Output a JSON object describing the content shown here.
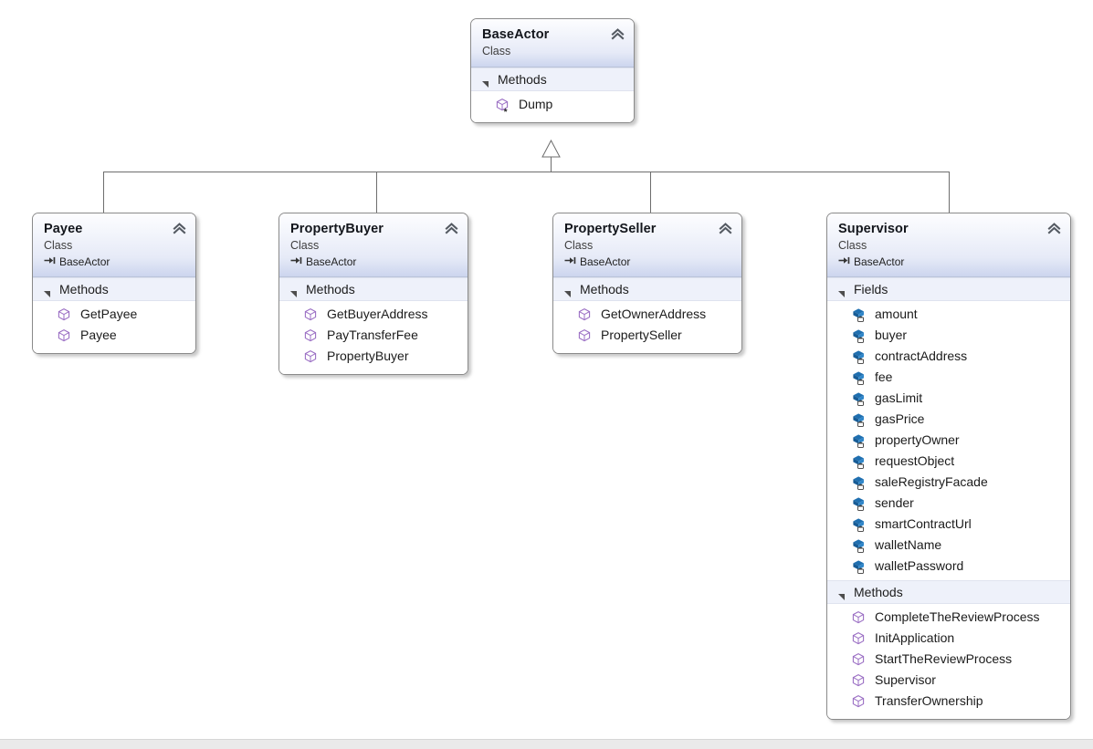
{
  "diagram": {
    "type": "uml-class-diagram",
    "base_class_name": "BaseActor",
    "relationship": "inheritance",
    "colors": {
      "canvas": "#ffffff",
      "box_border": "#8a8a8a",
      "header_gradient_top": "#fdfdff",
      "header_gradient_bottom": "#ccd5ee",
      "compartment_band": "#eef1fa",
      "method_icon": "#8e63b5",
      "field_icon": "#1f6fb0",
      "connector_line": "#6d6d6d"
    }
  },
  "classes": [
    {
      "id": "base-actor",
      "name": "BaseActor",
      "kind": "Class",
      "base": null,
      "collapse_icon": "chevron-up-double-icon",
      "compartments": [
        {
          "label": "Methods",
          "kind": "methods",
          "members": [
            {
              "name": "Dump",
              "icon": "method-icon",
              "modifier": "extension"
            }
          ]
        }
      ]
    },
    {
      "id": "payee",
      "name": "Payee",
      "kind": "Class",
      "base": "BaseActor",
      "collapse_icon": "chevron-up-double-icon",
      "compartments": [
        {
          "label": "Methods",
          "kind": "methods",
          "members": [
            {
              "name": "GetPayee",
              "icon": "method-icon"
            },
            {
              "name": "Payee",
              "icon": "method-icon"
            }
          ]
        }
      ]
    },
    {
      "id": "property-buyer",
      "name": "PropertyBuyer",
      "kind": "Class",
      "base": "BaseActor",
      "collapse_icon": "chevron-up-double-icon",
      "compartments": [
        {
          "label": "Methods",
          "kind": "methods",
          "members": [
            {
              "name": "GetBuyerAddress",
              "icon": "method-icon"
            },
            {
              "name": "PayTransferFee",
              "icon": "method-icon"
            },
            {
              "name": "PropertyBuyer",
              "icon": "method-icon"
            }
          ]
        }
      ]
    },
    {
      "id": "property-seller",
      "name": "PropertySeller",
      "kind": "Class",
      "base": "BaseActor",
      "collapse_icon": "chevron-up-double-icon",
      "compartments": [
        {
          "label": "Methods",
          "kind": "methods",
          "members": [
            {
              "name": "GetOwnerAddress",
              "icon": "method-icon"
            },
            {
              "name": "PropertySeller",
              "icon": "method-icon"
            }
          ]
        }
      ]
    },
    {
      "id": "supervisor",
      "name": "Supervisor",
      "kind": "Class",
      "base": "BaseActor",
      "collapse_icon": "chevron-up-double-icon",
      "compartments": [
        {
          "label": "Fields",
          "kind": "fields",
          "members": [
            {
              "name": "amount",
              "icon": "field-icon",
              "modifier": "private"
            },
            {
              "name": "buyer",
              "icon": "field-icon",
              "modifier": "private"
            },
            {
              "name": "contractAddress",
              "icon": "field-icon",
              "modifier": "private"
            },
            {
              "name": "fee",
              "icon": "field-icon",
              "modifier": "private"
            },
            {
              "name": "gasLimit",
              "icon": "field-icon",
              "modifier": "private"
            },
            {
              "name": "gasPrice",
              "icon": "field-icon",
              "modifier": "private"
            },
            {
              "name": "propertyOwner",
              "icon": "field-icon",
              "modifier": "private"
            },
            {
              "name": "requestObject",
              "icon": "field-icon",
              "modifier": "private"
            },
            {
              "name": "saleRegistryFacade",
              "icon": "field-icon",
              "modifier": "private"
            },
            {
              "name": "sender",
              "icon": "field-icon",
              "modifier": "private"
            },
            {
              "name": "smartContractUrl",
              "icon": "field-icon",
              "modifier": "private"
            },
            {
              "name": "walletName",
              "icon": "field-icon",
              "modifier": "private"
            },
            {
              "name": "walletPassword",
              "icon": "field-icon",
              "modifier": "private"
            }
          ]
        },
        {
          "label": "Methods",
          "kind": "methods",
          "members": [
            {
              "name": "CompleteTheReviewProcess",
              "icon": "method-icon"
            },
            {
              "name": "InitApplication",
              "icon": "method-icon"
            },
            {
              "name": "StartTheReviewProcess",
              "icon": "method-icon"
            },
            {
              "name": "Supervisor",
              "icon": "method-icon"
            },
            {
              "name": "TransferOwnership",
              "icon": "method-icon"
            }
          ]
        }
      ]
    }
  ]
}
